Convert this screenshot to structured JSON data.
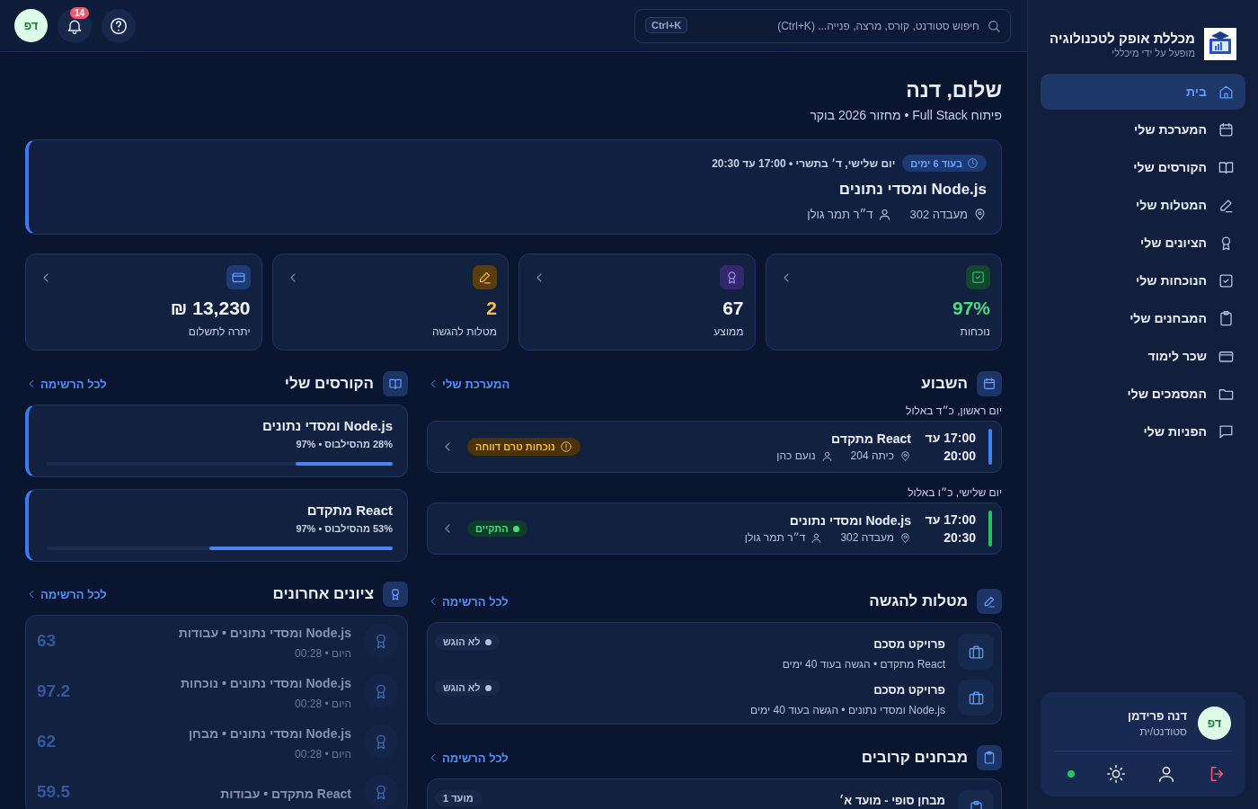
{
  "sidebar": {
    "brand": {
      "title": "מכללת אופק לטכנולוגיה",
      "subtitle": "מופעל על ידי מיכללי"
    },
    "items": [
      {
        "label": "בית",
        "kind": "home",
        "selected": true
      },
      {
        "label": "המערכת שלי",
        "kind": "calendar",
        "selected": false
      },
      {
        "label": "הקורסים שלי",
        "kind": "book",
        "selected": false
      },
      {
        "label": "המטלות שלי",
        "kind": "pencil",
        "selected": false
      },
      {
        "label": "הציונים שלי",
        "kind": "award",
        "selected": false
      },
      {
        "label": "הנוכחות שלי",
        "kind": "check",
        "selected": false
      },
      {
        "label": "המבחנים שלי",
        "kind": "clipboard",
        "selected": false
      },
      {
        "label": "שכר לימוד",
        "kind": "card",
        "selected": false
      },
      {
        "label": "המסמכים שלי",
        "kind": "folder",
        "selected": false
      },
      {
        "label": "הפניות שלי",
        "kind": "chat",
        "selected": false
      }
    ],
    "user": {
      "initials": "דפ",
      "name": "דנה פרידמן",
      "role": "סטודנט/ית",
      "online": true
    }
  },
  "header": {
    "search": {
      "placeholder": "חיפוש סטודנט, קורס, מרצה, פנייה... (Ctrl+K)",
      "shortcut": "Ctrl+K"
    },
    "notifications": "14",
    "avatar": "דפ"
  },
  "greeting": {
    "title": "שלום, דנה",
    "subtitle": "פיתוח Full Stack • מחזור 2026 בוקר"
  },
  "next_class": {
    "countdown": "בעוד 6 ימים",
    "when": "יום שלישי, ד׳ בתשרי • 17:00 עד 20:30",
    "title": "Node.js ומסדי נתונים",
    "room": "מעבדה 302",
    "lecturer": "ד״ר תמר גולן"
  },
  "stats": [
    {
      "kind": "attendance",
      "value": "97%",
      "label": "נוכחות"
    },
    {
      "kind": "average",
      "value": "67",
      "label": "ממוצע"
    },
    {
      "kind": "assignments",
      "value": "2",
      "label": "מטלות להגשה"
    },
    {
      "kind": "balance",
      "value": "13,230 ₪",
      "label": "יתרה לתשלום"
    }
  ],
  "week": {
    "title": "השבוע",
    "link": "המערכת שלי",
    "days": [
      {
        "date": "יום ראשון, כ״ד באלול",
        "sessions": [
          {
            "start": "17:00 עד",
            "end": "20:00",
            "title": "React מתקדם",
            "room": "כיתה 204",
            "lecturer": "נועם כהן",
            "status": {
              "kind": "warning",
              "label": "נוכחות טרם דווחה"
            }
          }
        ]
      },
      {
        "date": "יום שלישי, כ״ו באלול",
        "sessions": [
          {
            "start": "17:00 עד",
            "end": "20:30",
            "title": "Node.js ומסדי נתונים",
            "room": "מעבדה 302",
            "lecturer": "ד״ר תמר גולן",
            "status": {
              "kind": "done",
              "label": "התקיים"
            }
          }
        ]
      }
    ]
  },
  "assignments": {
    "title": "מטלות להגשה",
    "link": "לכל הרשימה",
    "items": [
      {
        "title": "פרויקט מסכם",
        "detail": "React מתקדם • הגשה בעוד 40 ימים",
        "status": "לא הוגש"
      },
      {
        "title": "פרויקט מסכם",
        "detail": "Node.js ומסדי נתונים • הגשה בעוד 40 ימים",
        "status": "לא הוגש"
      }
    ]
  },
  "exams": {
    "title": "מבחנים קרובים",
    "link": "לכל הרשימה",
    "items": [
      {
        "title": "מבחן סופי - מועד א׳",
        "badge": "מועד 1"
      }
    ]
  },
  "courses": {
    "title": "הקורסים שלי",
    "link": "לכל הרשימה",
    "items": [
      {
        "title": "Node.js ומסדי נתונים",
        "detail": "28% מהסילבוס • 97%",
        "level": 0.28
      },
      {
        "title": "React מתקדם",
        "detail": "53% מהסילבוס • 97%",
        "level": 0.53
      }
    ]
  },
  "grades": {
    "title": "ציונים אחרונים",
    "link": "לכל הרשימה",
    "items": [
      {
        "title": "Node.js ומסדי נתונים • עבודות",
        "time": "היום • 00:28",
        "score": "63"
      },
      {
        "title": "Node.js ומסדי נתונים • נוכחות",
        "time": "היום • 00:28",
        "score": "97.2"
      },
      {
        "title": "Node.js ומסדי נתונים • מבחן",
        "time": "היום • 00:28",
        "score": "62"
      },
      {
        "title": "React מתקדם • עבודות",
        "score": "59.5"
      }
    ]
  }
}
